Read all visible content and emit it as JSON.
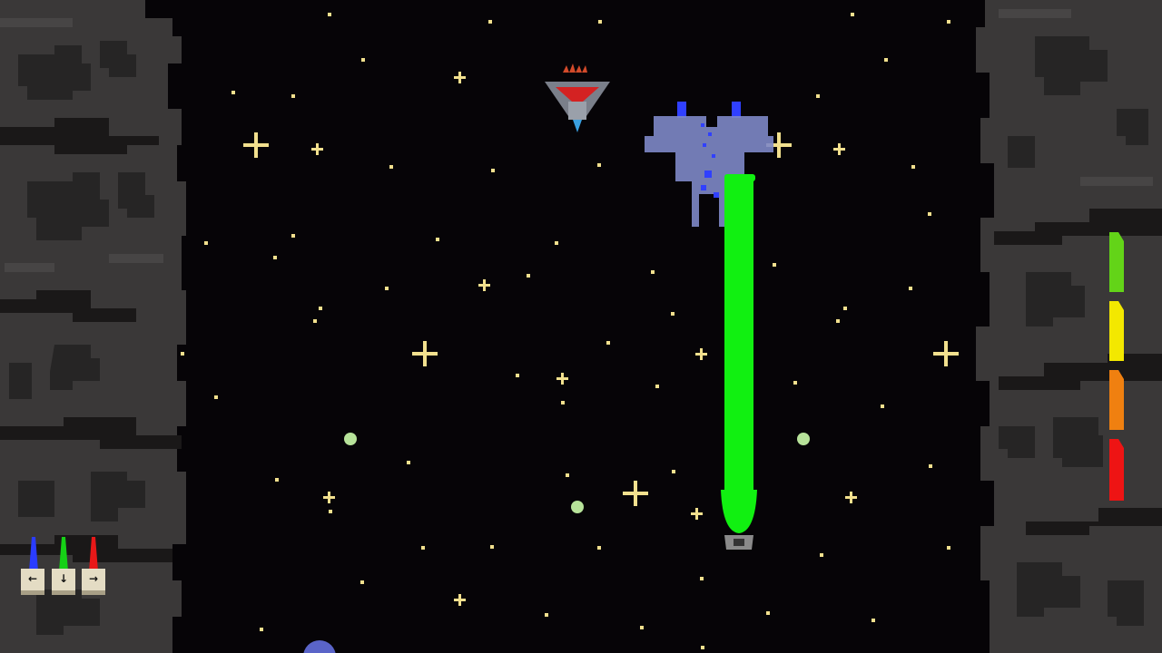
{
  "game": {
    "colors": {
      "space": "#060407",
      "rock": "#3a3838",
      "rock_dark": "#262525",
      "rock_light": "#474545",
      "star": "#f2e08e",
      "laser": "#11f011",
      "orb": "#b7e39a",
      "player_ship": "#7e88c8",
      "enemy_ship": "#7a7f8a",
      "enemy_accent": "#d42222"
    },
    "controls": [
      {
        "key_glyph": "←",
        "beam_color": "#2a3cff",
        "icon": "left-arrow-key-icon"
      },
      {
        "key_glyph": "↓",
        "beam_color": "#16d116",
        "icon": "down-arrow-key-icon"
      },
      {
        "key_glyph": "→",
        "beam_color": "#e81818",
        "icon": "right-arrow-key-icon"
      }
    ],
    "health_meter": {
      "segments": [
        {
          "color": "#63d418",
          "lit": true
        },
        {
          "color": "#f3e800",
          "lit": true
        },
        {
          "color": "#f08010",
          "lit": true
        },
        {
          "color": "#ee1414",
          "lit": true
        }
      ]
    },
    "weapon": {
      "active_beam": "green-laser"
    }
  }
}
